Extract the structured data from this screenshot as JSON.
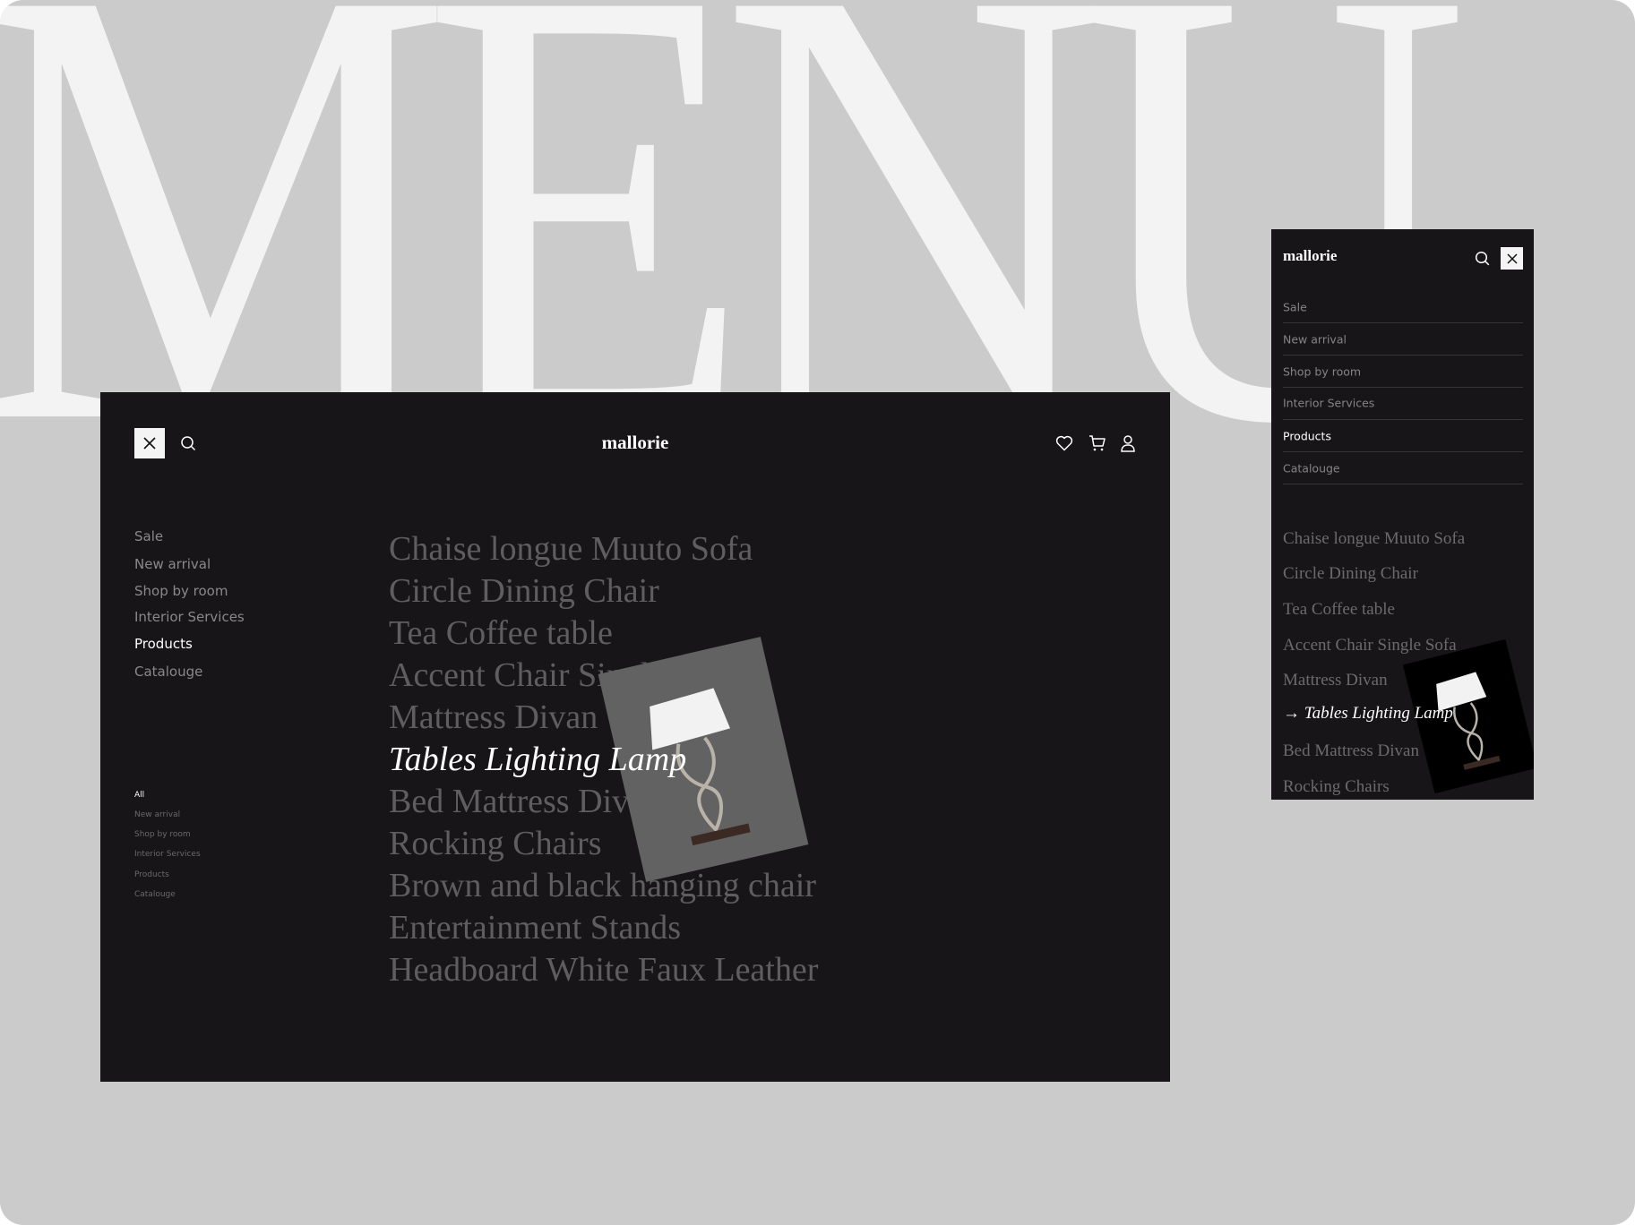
{
  "backdrop": {
    "word": "MENU"
  },
  "desktop": {
    "logo": "mallorie",
    "icons": {
      "close": "close-icon",
      "search": "search-icon",
      "wishlist": "heart-icon",
      "cart": "cart-icon",
      "account": "user-icon"
    },
    "nav": [
      {
        "label": "Sale",
        "active": false
      },
      {
        "label": "New arrival",
        "active": false
      },
      {
        "label": "Shop by room",
        "active": false
      },
      {
        "label": "Interior Services",
        "active": false
      },
      {
        "label": "Products",
        "active": true
      },
      {
        "label": "Catalouge",
        "active": false
      }
    ],
    "filters": [
      {
        "label": "All",
        "active": true
      },
      {
        "label": "New arrival",
        "active": false
      },
      {
        "label": "Shop by room",
        "active": false
      },
      {
        "label": "Interior Services",
        "active": false
      },
      {
        "label": "Products",
        "active": false
      },
      {
        "label": "Catalouge",
        "active": false
      }
    ],
    "products": [
      "Chaise longue Muuto Sofa",
      "Circle Dining Chair",
      "Tea Coffee table",
      "Accent Chair Single Sofa",
      "Mattress Divan",
      "Tables Lighting Lamp",
      "Bed Mattress Divan",
      "Rocking Chairs",
      "Brown and black hanging chair",
      "Entertainment Stands",
      "Headboard White Faux Leather"
    ],
    "active_product": "Tables Lighting Lamp",
    "preview_image": "table-lamp"
  },
  "mobile": {
    "logo": "mallorie",
    "nav": [
      {
        "label": "Sale",
        "active": false
      },
      {
        "label": "New arrival",
        "active": false
      },
      {
        "label": "Shop by room",
        "active": false
      },
      {
        "label": "Interior Services",
        "active": false
      },
      {
        "label": "Products",
        "active": true
      },
      {
        "label": "Catalouge",
        "active": false
      }
    ],
    "products": [
      "Chaise longue Muuto Sofa",
      "Circle Dining Chair",
      "Tea Coffee table",
      "Accent Chair Single Sofa",
      "Mattress Divan",
      "Tables Lighting Lamp",
      "Bed Mattress Divan",
      "Rocking Chairs"
    ],
    "active_arrow": "→"
  },
  "colors": {
    "background": "#cbcbcb",
    "panel": "#171517",
    "text_muted": "#5f5d5f",
    "text_active": "#ffffff"
  }
}
